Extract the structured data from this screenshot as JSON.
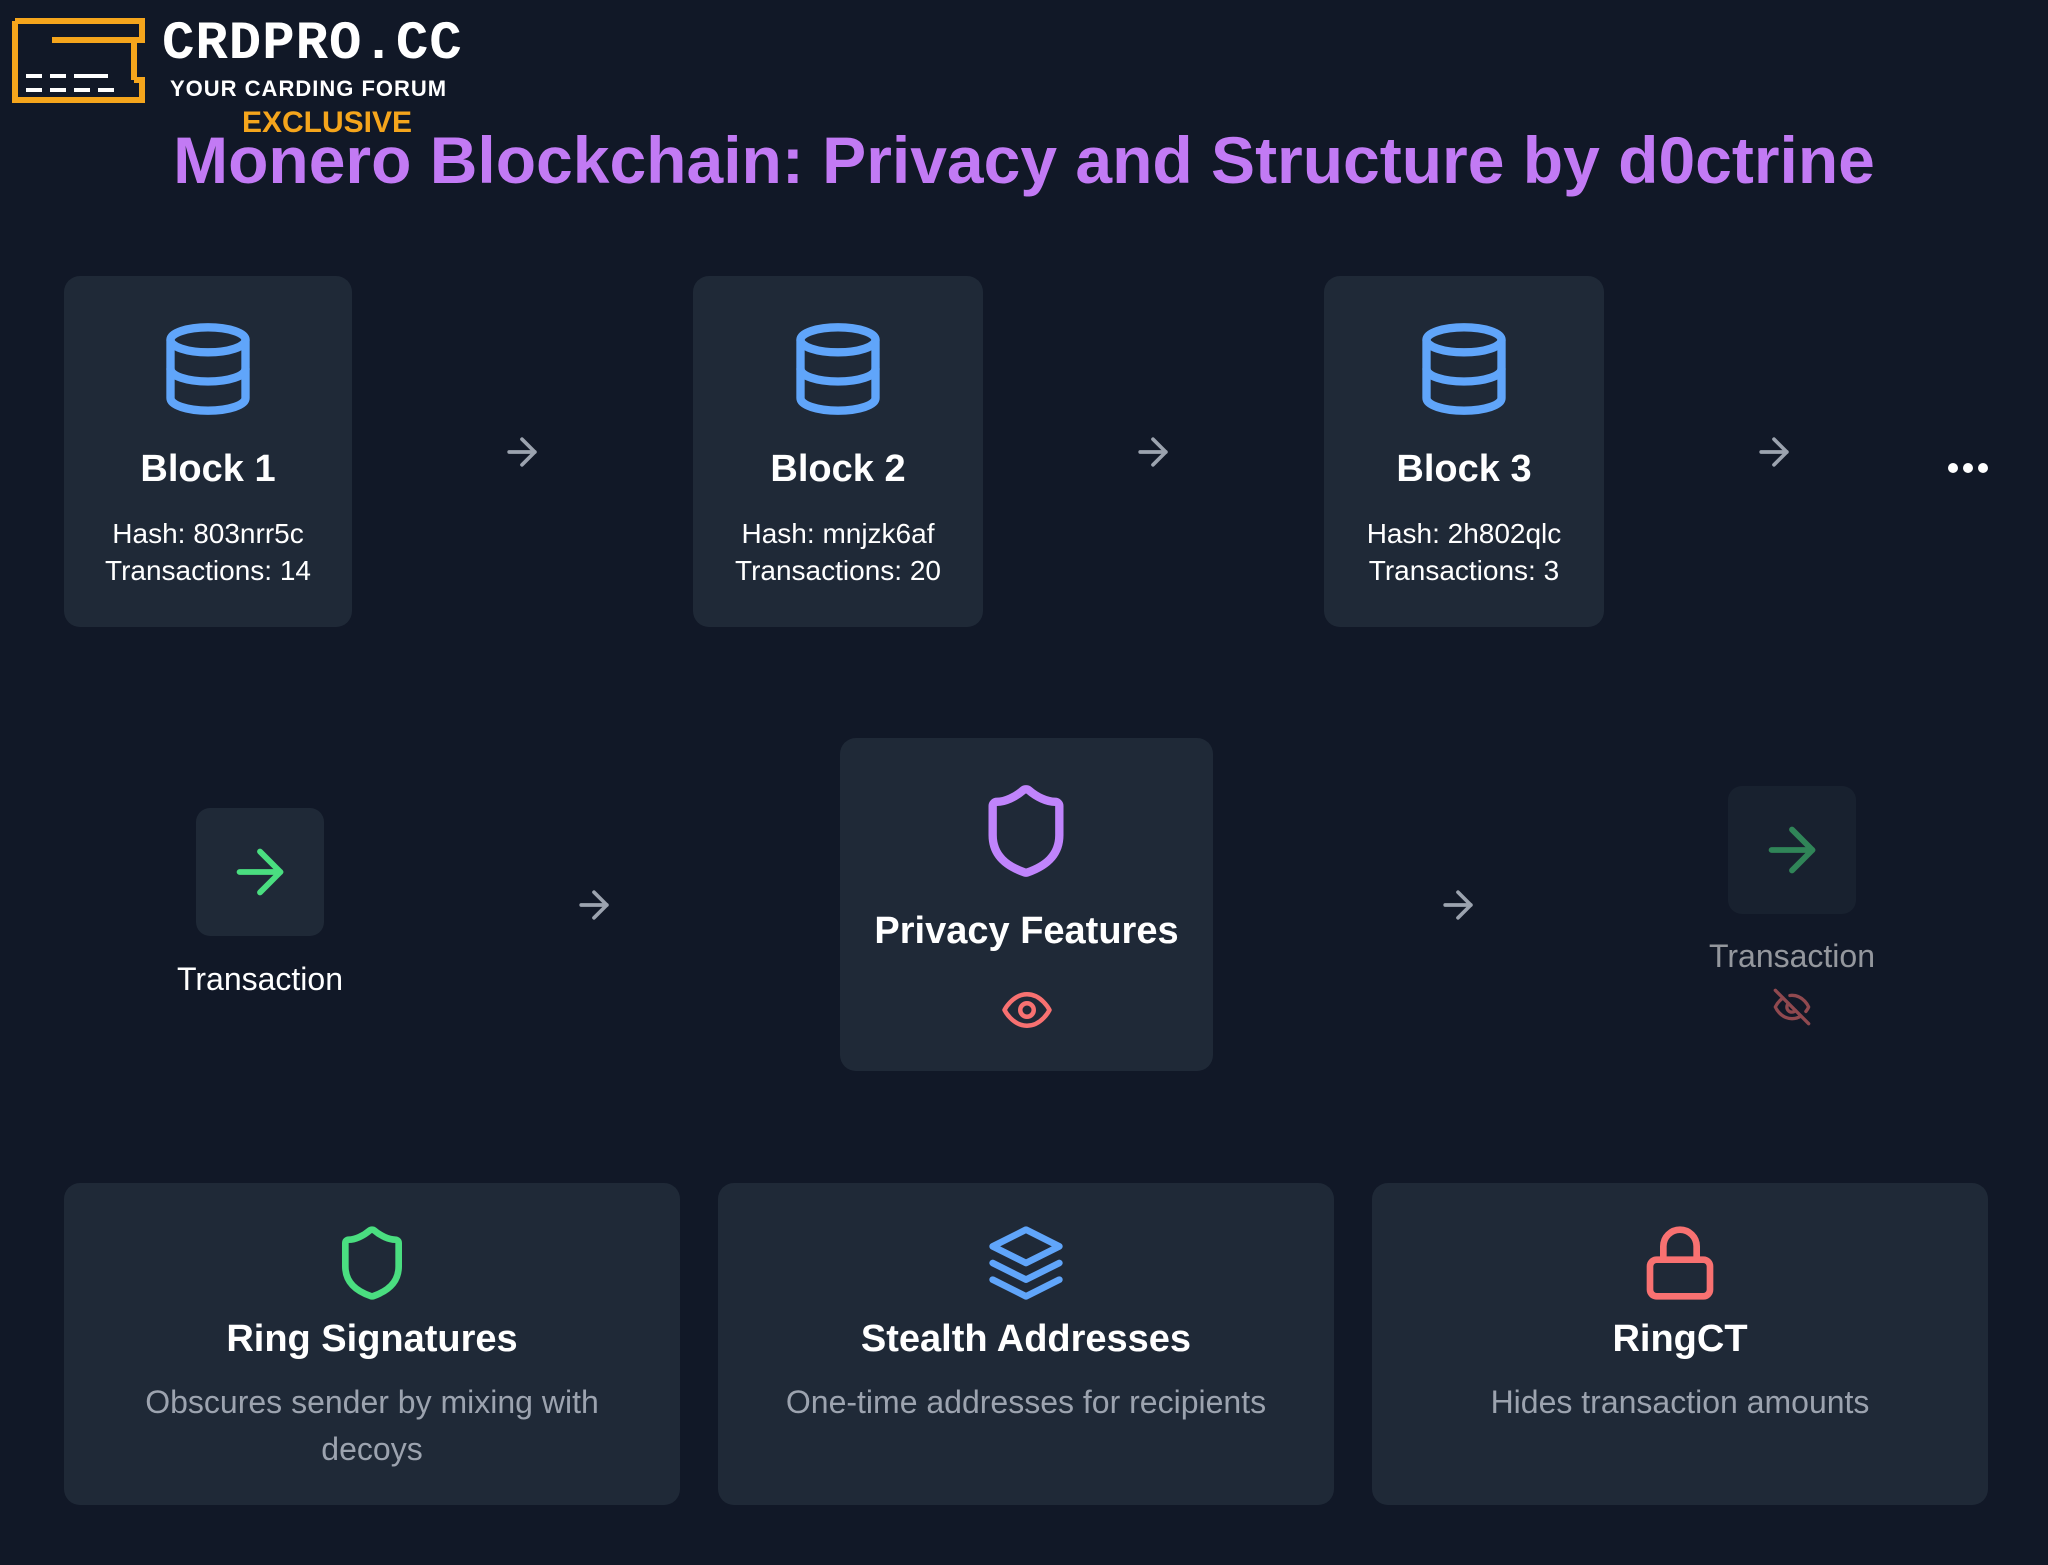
{
  "logo": {
    "title": "CRDPRO.CC",
    "subtitle": "YOUR CARDING FORUM",
    "badge": "EXCLUSIVE"
  },
  "title": "Monero Blockchain: Privacy and Structure by d0ctrine",
  "blocks": [
    {
      "name": "Block 1",
      "hash": "Hash: 803nrr5c",
      "transactions": "Transactions: 14"
    },
    {
      "name": "Block 2",
      "hash": "Hash: mnjzk6af",
      "transactions": "Transactions: 20"
    },
    {
      "name": "Block 3",
      "hash": "Hash: 2h802qlc",
      "transactions": "Transactions: 3"
    }
  ],
  "flow": {
    "input_label": "Transaction",
    "center_label": "Privacy Features",
    "output_label": "Transaction"
  },
  "features": [
    {
      "title": "Ring Signatures",
      "description": "Obscures sender by mixing with decoys",
      "icon": "shield-icon"
    },
    {
      "title": "Stealth Addresses",
      "description": "One-time addresses for recipients",
      "icon": "layers-icon"
    },
    {
      "title": "RingCT",
      "description": "Hides transaction amounts",
      "icon": "lock-icon"
    }
  ],
  "colors": {
    "background": "#111827",
    "card": "#1f2937",
    "title": "#c27af4",
    "block_icon": "#60a5fa",
    "green": "#4ade80",
    "purple": "#c084fc",
    "red": "#f87171",
    "muted_text": "#9ca3af",
    "logo_accent": "#f5a51c"
  }
}
